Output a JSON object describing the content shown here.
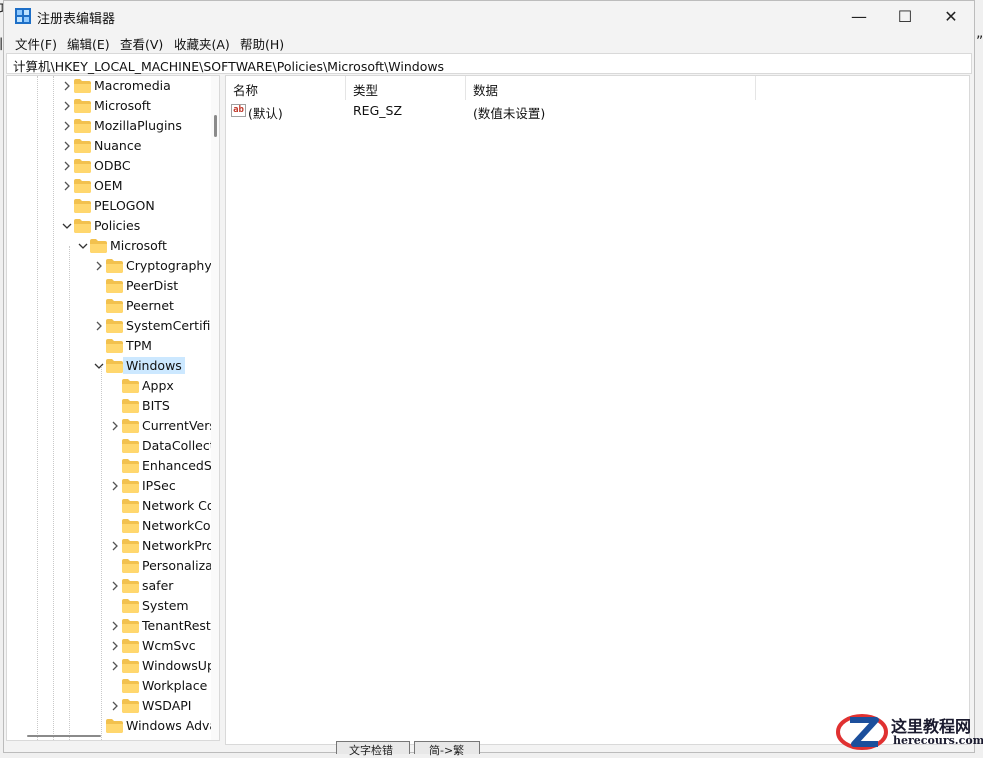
{
  "background": {
    "frag_top": "攻",
    "frag_mid": "旧",
    "frag_right": "”",
    "taskbar_frag_1": "文字检错",
    "taskbar_frag_2": "简->繁"
  },
  "window": {
    "title": "注册表编辑器",
    "controls": {
      "minimize": "—",
      "maximize": "☐",
      "close": "✕"
    }
  },
  "menu": [
    {
      "label": "文件(F)"
    },
    {
      "label": "编辑(E)"
    },
    {
      "label": "查看(V)"
    },
    {
      "label": "收藏夹(A)"
    },
    {
      "label": "帮助(H)"
    }
  ],
  "address": "计算机\\HKEY_LOCAL_MACHINE\\SOFTWARE\\Policies\\Microsoft\\Windows",
  "tree": [
    {
      "label": "Macromedia",
      "level": 0,
      "expander": "collapsed"
    },
    {
      "label": "Microsoft",
      "level": 0,
      "expander": "collapsed"
    },
    {
      "label": "MozillaPlugins",
      "level": 0,
      "expander": "collapsed"
    },
    {
      "label": "Nuance",
      "level": 0,
      "expander": "collapsed"
    },
    {
      "label": "ODBC",
      "level": 0,
      "expander": "collapsed"
    },
    {
      "label": "OEM",
      "level": 0,
      "expander": "collapsed"
    },
    {
      "label": "PELOGON",
      "level": 0,
      "expander": "none"
    },
    {
      "label": "Policies",
      "level": 0,
      "expander": "expanded"
    },
    {
      "label": "Microsoft",
      "level": 1,
      "expander": "expanded"
    },
    {
      "label": "Cryptography",
      "level": 2,
      "expander": "collapsed"
    },
    {
      "label": "PeerDist",
      "level": 2,
      "expander": "none"
    },
    {
      "label": "Peernet",
      "level": 2,
      "expander": "none"
    },
    {
      "label": "SystemCertificates",
      "level": 2,
      "expander": "collapsed"
    },
    {
      "label": "TPM",
      "level": 2,
      "expander": "none"
    },
    {
      "label": "Windows",
      "level": 2,
      "expander": "expanded",
      "selected": true
    },
    {
      "label": "Appx",
      "level": 3,
      "expander": "none"
    },
    {
      "label": "BITS",
      "level": 3,
      "expander": "none"
    },
    {
      "label": "CurrentVersion",
      "level": 3,
      "expander": "collapsed"
    },
    {
      "label": "DataCollection",
      "level": 3,
      "expander": "none"
    },
    {
      "label": "EnhancedStorage",
      "level": 3,
      "expander": "none"
    },
    {
      "label": "IPSec",
      "level": 3,
      "expander": "collapsed"
    },
    {
      "label": "Network Connections",
      "level": 3,
      "expander": "none"
    },
    {
      "label": "NetworkConnectivity",
      "level": 3,
      "expander": "none"
    },
    {
      "label": "NetworkProvider",
      "level": 3,
      "expander": "collapsed"
    },
    {
      "label": "Personalization",
      "level": 3,
      "expander": "none"
    },
    {
      "label": "safer",
      "level": 3,
      "expander": "collapsed"
    },
    {
      "label": "System",
      "level": 3,
      "expander": "none"
    },
    {
      "label": "TenantRestrictions",
      "level": 3,
      "expander": "collapsed"
    },
    {
      "label": "WcmSvc",
      "level": 3,
      "expander": "collapsed"
    },
    {
      "label": "WindowsUpdate",
      "level": 3,
      "expander": "collapsed"
    },
    {
      "label": "Workplace",
      "level": 3,
      "expander": "none"
    },
    {
      "label": "WSDAPI",
      "level": 3,
      "expander": "collapsed"
    },
    {
      "label": "Windows Advanced Threat Protection",
      "level": 2,
      "expander": "none"
    }
  ],
  "list": {
    "columns": [
      "名称",
      "类型",
      "数据"
    ],
    "rows": [
      {
        "name": "(默认)",
        "type": "REG_SZ",
        "data": "(数值未设置)",
        "icon": "string-value-icon"
      }
    ]
  },
  "watermark": {
    "title": "这里教程网",
    "url": "herecours.com",
    "colors": {
      "red": "#e03131",
      "blue": "#1c4f9c"
    }
  }
}
